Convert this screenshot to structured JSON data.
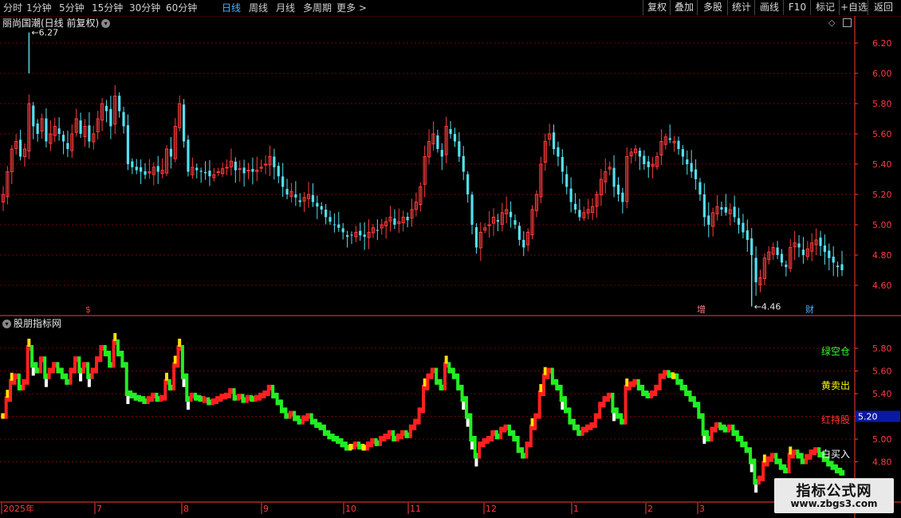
{
  "toolbar": {
    "timeframes": [
      "分时",
      "1分钟",
      "5分钟",
      "15分钟",
      "30分钟",
      "60分钟",
      "日线",
      "周线",
      "月线",
      "多周期",
      "更多 >"
    ],
    "active_timeframe": "日线",
    "buttons": [
      "复权",
      "叠加",
      "多股",
      "统计",
      "画线",
      "F10",
      "标记",
      "+自选",
      "返回"
    ]
  },
  "main_panel": {
    "title": "丽尚国潮(日线 前复权)",
    "price_axis": [
      "6.20",
      "6.00",
      "5.80",
      "5.60",
      "5.40",
      "5.20",
      "5.00",
      "4.80",
      "4.60"
    ],
    "high_label": "6.27",
    "low_label": "4.46",
    "event_markers": [
      "$",
      "增",
      "财"
    ],
    "colors": {
      "up": "#ff3b3b",
      "down": "#54e0f0",
      "grid": "#7a0000",
      "axis": "#ff3b3b"
    }
  },
  "indicator_panel": {
    "title": "股朋指标网",
    "price_axis": [
      "5.80",
      "5.60",
      "5.40",
      "5.20",
      "5.00",
      "4.80"
    ],
    "current_value": "5.20",
    "legend": [
      {
        "text": "绿空仓",
        "color": "#33ff33"
      },
      {
        "text": "黄卖出",
        "color": "#ffff00"
      },
      {
        "text": "红持股",
        "color": "#ff3333"
      },
      {
        "text": "白买入",
        "color": "#ffffff"
      }
    ]
  },
  "time_axis": {
    "labels": [
      "2025年",
      "7",
      "8",
      "9",
      "10",
      "11",
      "12",
      "1",
      "2",
      "3"
    ]
  },
  "chart_data": {
    "type": "candlestick",
    "title": "丽尚国潮(日线 前复权)",
    "ylim": [
      4.46,
      6.27
    ],
    "period_start_label": "2025年",
    "month_labels": [
      "7",
      "8",
      "9",
      "10",
      "11",
      "12",
      "1",
      "2",
      "3"
    ],
    "closes": [
      5.2,
      5.35,
      5.5,
      5.55,
      5.45,
      5.5,
      5.8,
      5.65,
      5.6,
      5.7,
      5.55,
      5.6,
      5.65,
      5.6,
      5.55,
      5.5,
      5.6,
      5.7,
      5.6,
      5.65,
      5.55,
      5.6,
      5.7,
      5.8,
      5.75,
      5.65,
      5.85,
      5.75,
      5.65,
      5.4,
      5.38,
      5.36,
      5.35,
      5.33,
      5.35,
      5.38,
      5.35,
      5.36,
      5.5,
      5.45,
      5.65,
      5.8,
      5.55,
      5.35,
      5.38,
      5.36,
      5.35,
      5.34,
      5.32,
      5.33,
      5.35,
      5.37,
      5.38,
      5.42,
      5.36,
      5.37,
      5.34,
      5.36,
      5.35,
      5.36,
      5.38,
      5.4,
      5.45,
      5.38,
      5.32,
      5.25,
      5.2,
      5.22,
      5.18,
      5.15,
      5.18,
      5.2,
      5.15,
      5.12,
      5.1,
      5.05,
      5.02,
      5.0,
      4.98,
      4.95,
      4.92,
      4.93,
      4.95,
      4.93,
      4.92,
      4.95,
      4.98,
      4.96,
      5.0,
      5.02,
      5.05,
      5.0,
      5.02,
      5.05,
      5.03,
      5.1,
      5.15,
      5.25,
      5.45,
      5.55,
      5.6,
      5.5,
      5.45,
      5.65,
      5.6,
      5.55,
      5.45,
      5.35,
      5.2,
      5.0,
      4.85,
      4.95,
      4.98,
      5.0,
      5.05,
      5.02,
      5.08,
      5.1,
      5.05,
      5.0,
      4.9,
      4.85,
      4.95,
      5.1,
      5.2,
      5.4,
      5.55,
      5.6,
      5.5,
      5.45,
      5.35,
      5.25,
      5.15,
      5.1,
      5.05,
      5.08,
      5.1,
      5.12,
      5.2,
      5.3,
      5.35,
      5.38,
      5.25,
      5.2,
      5.15,
      5.45,
      5.48,
      5.5,
      5.45,
      5.4,
      5.38,
      5.4,
      5.45,
      5.55,
      5.58,
      5.56,
      5.55,
      5.5,
      5.45,
      5.4,
      5.35,
      5.3,
      5.2,
      5.05,
      5.0,
      5.08,
      5.12,
      5.1,
      5.08,
      5.1,
      5.05,
      5.0,
      4.95,
      4.9,
      4.8,
      4.62,
      4.65,
      4.78,
      4.82,
      4.85,
      4.8,
      4.75,
      4.72,
      4.85,
      4.88,
      4.85,
      4.8,
      4.84,
      4.88,
      4.9,
      4.86,
      4.82,
      4.78,
      4.75,
      4.72,
      4.7
    ]
  }
}
